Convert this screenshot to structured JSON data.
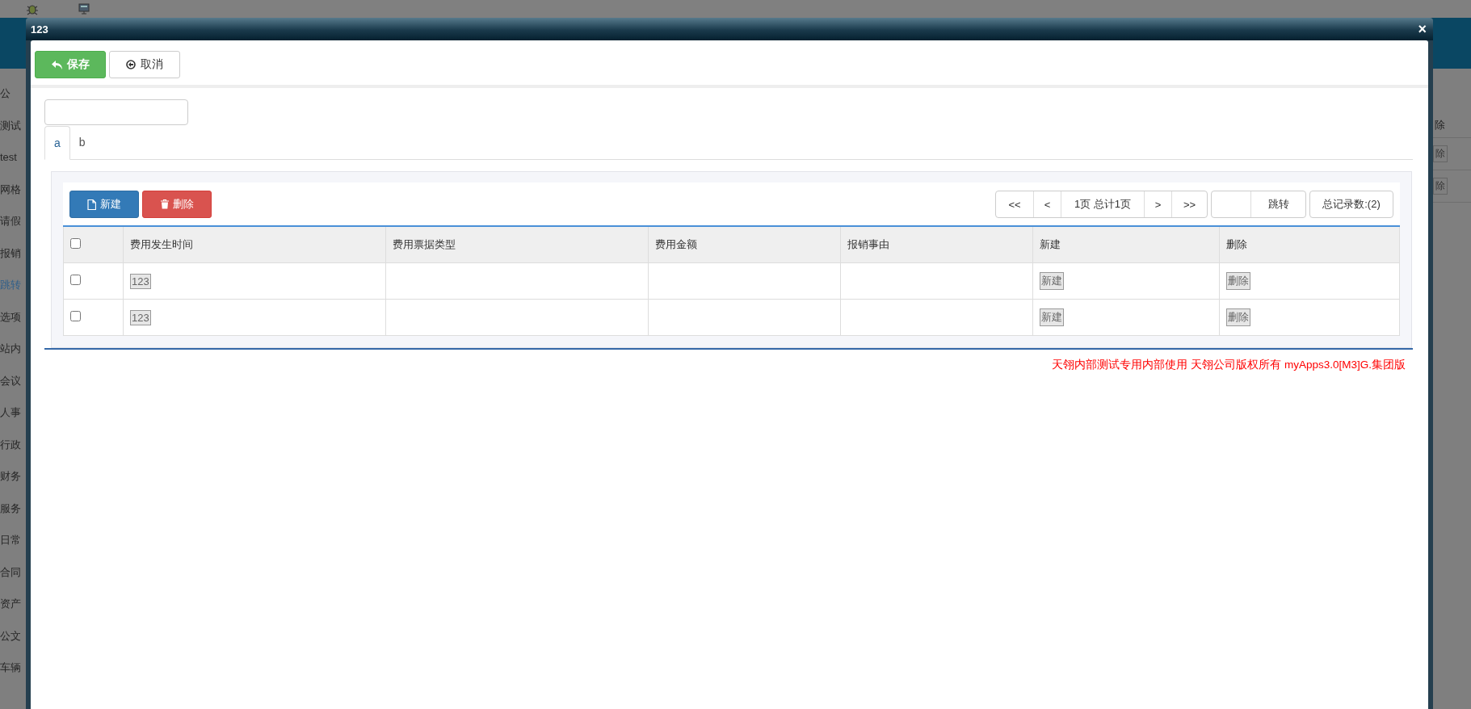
{
  "background": {
    "sidebar": {
      "items": [
        {
          "label": "公",
          "selected": false
        },
        {
          "label": "测试",
          "selected": false
        },
        {
          "label": "test",
          "selected": false
        },
        {
          "label": "网格",
          "selected": false
        },
        {
          "label": "请假",
          "selected": false
        },
        {
          "label": "报销",
          "selected": false
        },
        {
          "label": "跳转",
          "selected": true
        },
        {
          "label": "选项",
          "selected": false
        },
        {
          "label": "站内",
          "selected": false
        },
        {
          "label": "会议",
          "selected": false
        },
        {
          "label": "人事",
          "selected": false
        },
        {
          "label": "行政",
          "selected": false
        },
        {
          "label": "财务",
          "selected": false
        },
        {
          "label": "服务",
          "selected": false
        },
        {
          "label": "日常",
          "selected": false
        },
        {
          "label": "合同",
          "selected": false
        },
        {
          "label": "资产",
          "selected": false
        },
        {
          "label": "公文",
          "selected": false
        },
        {
          "label": "车辆",
          "selected": false
        }
      ]
    },
    "right_panel": {
      "header": "除",
      "row_buttons": [
        "除",
        "除"
      ]
    }
  },
  "window": {
    "title": "123",
    "close": "×"
  },
  "toolbar": [
    {
      "label": "保存",
      "kind": "primary"
    },
    {
      "label": "取消",
      "kind": "default"
    }
  ],
  "tabs": [
    {
      "label": "a",
      "selected": true
    },
    {
      "label": "b",
      "selected": false
    }
  ],
  "grid": {
    "actions": [
      {
        "label": "新建",
        "kind": "new"
      },
      {
        "label": "删除",
        "kind": "delete"
      }
    ],
    "pagination": {
      "first": "<<",
      "prev": "<",
      "info": "1页 总计1页",
      "next": ">",
      "last": ">>",
      "jump": "跳转",
      "total": "总记录数:(2)"
    },
    "header_checked": false,
    "columns": [
      "费用发生时间",
      "费用票据类型",
      "费用金额",
      "报销事由",
      "新建",
      "删除"
    ],
    "rows": [
      {
        "checked": false,
        "cells": [
          {
            "kind": "button",
            "text": "123"
          },
          {
            "kind": "empty"
          },
          {
            "kind": "empty"
          },
          {
            "kind": "empty"
          },
          {
            "kind": "button",
            "text": "新建"
          },
          {
            "kind": "button",
            "text": "删除"
          }
        ]
      },
      {
        "checked": false,
        "cells": [
          {
            "kind": "button",
            "text": "123"
          },
          {
            "kind": "empty"
          },
          {
            "kind": "empty"
          },
          {
            "kind": "empty"
          },
          {
            "kind": "button",
            "text": "新建"
          },
          {
            "kind": "button",
            "text": "删除"
          }
        ]
      }
    ]
  },
  "footer": "天翎内部测试专用内部使用 天翎公司版权所有 myApps3.0[M3]G.集团版"
}
